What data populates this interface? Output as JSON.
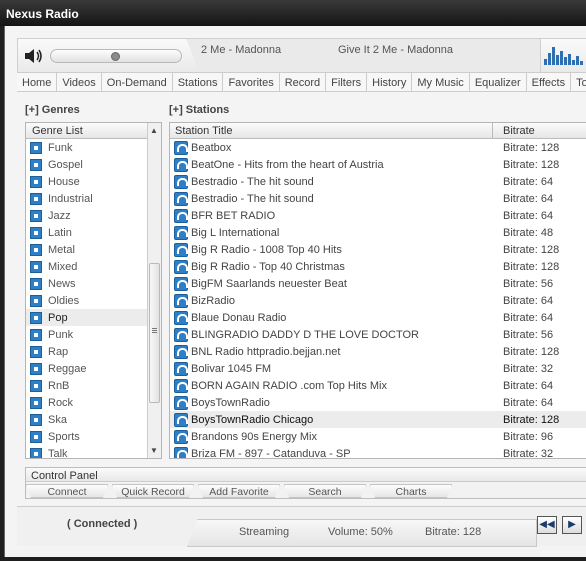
{
  "window": {
    "title": "Nexus Radio"
  },
  "player": {
    "now_playing_short": "2 Me - Madonna",
    "now_playing_full": "Give It 2 Me - Madonna",
    "volume_level": 0.5
  },
  "tabs": [
    "Home",
    "Videos",
    "On-Demand",
    "Stations",
    "Favorites",
    "Record",
    "Filters",
    "History",
    "My Music",
    "Equalizer",
    "Effects",
    "Too"
  ],
  "genres": {
    "header": "[+] Genres",
    "column": "Genre List",
    "items": [
      "Funk",
      "Gospel",
      "House",
      "Industrial",
      "Jazz",
      "Latin",
      "Metal",
      "Mixed",
      "News",
      "Oldies",
      "Pop",
      "Punk",
      "Rap",
      "Reggae",
      "RnB",
      "Rock",
      "Ska",
      "Sports",
      "Talk"
    ],
    "selected": "Pop"
  },
  "stations": {
    "header": "[+] Stations",
    "col_title": "Station Title",
    "col_bitrate": "Bitrate",
    "selected": "BoysTownRadio Chicago",
    "rows": [
      {
        "title": "Beatbox",
        "bitrate": "Bitrate: 128"
      },
      {
        "title": "BeatOne - Hits from the heart of Austria",
        "bitrate": "Bitrate: 128"
      },
      {
        "title": "Bestradio  - The hit sound",
        "bitrate": "Bitrate: 64"
      },
      {
        "title": "Bestradio - The hit sound",
        "bitrate": "Bitrate: 64"
      },
      {
        "title": "BFR BET RADIO",
        "bitrate": "Bitrate: 64"
      },
      {
        "title": "Big L International",
        "bitrate": "Bitrate: 48"
      },
      {
        "title": "Big R Radio - 1008 Top 40 Hits",
        "bitrate": "Bitrate: 128"
      },
      {
        "title": "Big R Radio - Top 40 Christmas",
        "bitrate": "Bitrate: 128"
      },
      {
        "title": "BigFM Saarlands neuester Beat",
        "bitrate": "Bitrate: 56"
      },
      {
        "title": "BizRadio",
        "bitrate": "Bitrate: 64"
      },
      {
        "title": "Blaue Donau Radio",
        "bitrate": "Bitrate: 64"
      },
      {
        "title": "BLINGRADIO   DADDY D  THE LOVE DOCTOR",
        "bitrate": "Bitrate: 56"
      },
      {
        "title": "BNL Radio httpradio.bejjan.net",
        "bitrate": "Bitrate: 128"
      },
      {
        "title": "Bolivar 1045 FM",
        "bitrate": "Bitrate: 32"
      },
      {
        "title": "BORN AGAIN RADIO .com Top Hits Mix",
        "bitrate": "Bitrate: 64"
      },
      {
        "title": "BoysTownRadio",
        "bitrate": "Bitrate: 64"
      },
      {
        "title": "BoysTownRadio Chicago",
        "bitrate": "Bitrate: 128"
      },
      {
        "title": "Brandons 90s Energy Mix",
        "bitrate": "Bitrate: 96"
      },
      {
        "title": "Briza FM - 897 - Catanduva - SP",
        "bitrate": "Bitrate: 32"
      }
    ]
  },
  "control_panel": {
    "title": "Control Panel",
    "buttons": [
      "Connect",
      "Quick Record",
      "Add Favorite",
      "Search",
      "Charts"
    ]
  },
  "status": {
    "connection": "( Connected )",
    "state": "Streaming",
    "volume": "Volume: 50%",
    "bitrate": "Bitrate: 128"
  },
  "colors": {
    "accent": "#2f7fc6",
    "selection": "#ececec"
  }
}
